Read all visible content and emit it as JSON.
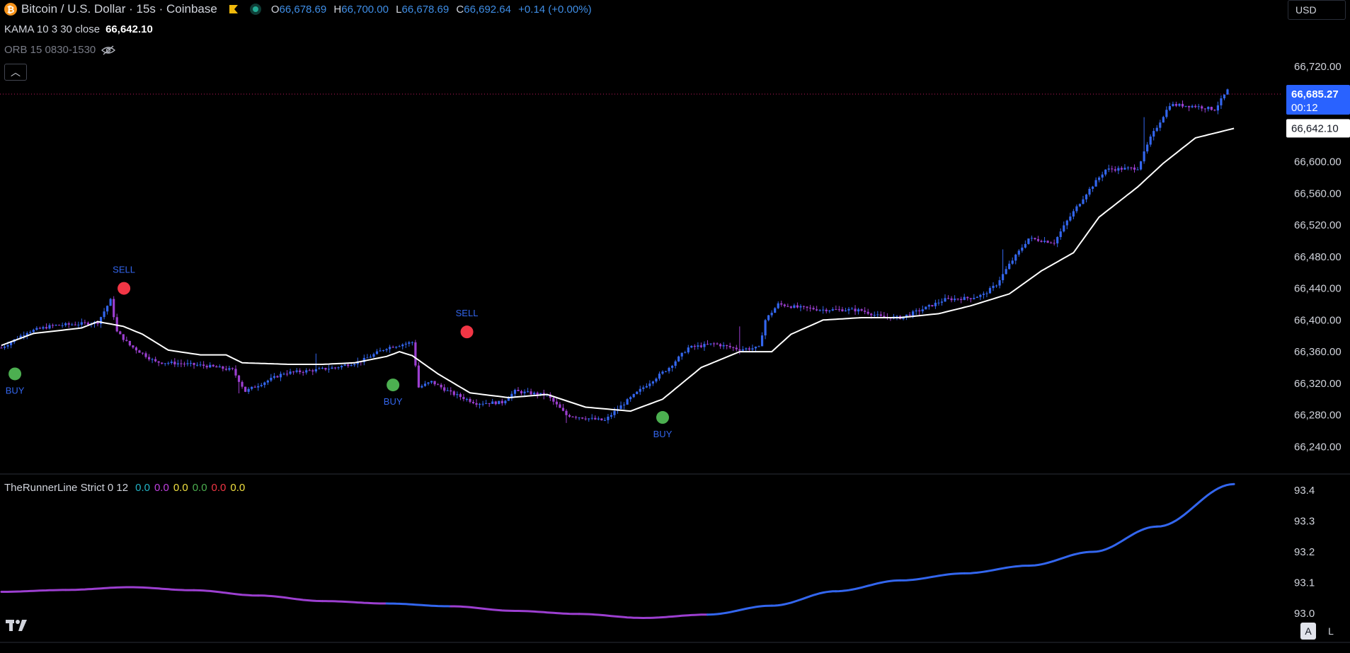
{
  "header": {
    "symbol_title": "Bitcoin / U.S. Dollar · 15s · Coinbase",
    "open_label": "O",
    "open": "66,678.69",
    "high_label": "H",
    "high": "66,700.00",
    "low_label": "L",
    "low": "66,678.69",
    "close_label": "C",
    "close": "66,692.64",
    "change": "+0.14 (+0.00%)",
    "currency": "USD"
  },
  "indicators": {
    "kama_label": "KAMA 10 3 30 close",
    "kama_value": "66,642.10",
    "orb_label": "ORB 15 0830-1530",
    "runner_label": "TheRunnerLine Strict 0 12",
    "runner_values": [
      "0.0",
      "0.0",
      "0.0",
      "0.0",
      "0.0",
      "0.0"
    ],
    "runner_value_colors": [
      "#22b3c6",
      "#c040e0",
      "#f0e040",
      "#4caf50",
      "#f23645",
      "#f0e040"
    ]
  },
  "price_tags": {
    "last_price": "66,685.27",
    "countdown": "00:12",
    "kama_tag": "66,642.10"
  },
  "bottom_controls": {
    "auto": "A",
    "log": "L"
  },
  "colors": {
    "up": "#3366ee",
    "down": "#9c3fd0",
    "kama": "#ffffff",
    "buy": "#4caf50",
    "sell": "#f23645",
    "signal_text": "#3366ee",
    "last_price_bg": "#2962ff"
  },
  "chart_data": [
    {
      "type": "candlestick",
      "title": "Bitcoin / U.S. Dollar · 15s · Coinbase",
      "ylim": [
        66210,
        66755
      ],
      "y_ticks": [
        "66,720.00",
        "66,680.00",
        "66,640.00",
        "66,600.00",
        "66,560.00",
        "66,520.00",
        "66,480.00",
        "66,440.00",
        "66,400.00",
        "66,360.00",
        "66,320.00",
        "66,280.00",
        "66,240.00"
      ],
      "price_segments": [
        [
          0,
          66365
        ],
        [
          8,
          66385
        ],
        [
          16,
          66393
        ],
        [
          24,
          66395
        ],
        [
          30,
          66397
        ],
        [
          34,
          66425
        ],
        [
          36,
          66385
        ],
        [
          40,
          66368
        ],
        [
          48,
          66347
        ],
        [
          56,
          66345
        ],
        [
          64,
          66342
        ],
        [
          72,
          66337
        ],
        [
          76,
          66310
        ],
        [
          80,
          66318
        ],
        [
          88,
          66333
        ],
        [
          96,
          66336
        ],
        [
          104,
          66340
        ],
        [
          112,
          66348
        ],
        [
          120,
          66365
        ],
        [
          128,
          66372
        ],
        [
          130,
          66315
        ],
        [
          134,
          66322
        ],
        [
          140,
          66308
        ],
        [
          148,
          66295
        ],
        [
          156,
          66296
        ],
        [
          160,
          66310
        ],
        [
          170,
          66305
        ],
        [
          176,
          66280
        ],
        [
          184,
          66275
        ],
        [
          188,
          66273
        ],
        [
          192,
          66288
        ],
        [
          200,
          66315
        ],
        [
          208,
          66340
        ],
        [
          214,
          66365
        ],
        [
          222,
          66370
        ],
        [
          230,
          66363
        ],
        [
          236,
          66365
        ],
        [
          238,
          66400
        ],
        [
          242,
          66420
        ],
        [
          248,
          66416
        ],
        [
          256,
          66413
        ],
        [
          264,
          66413
        ],
        [
          268,
          66412
        ],
        [
          274,
          66404
        ],
        [
          280,
          66403
        ],
        [
          286,
          66412
        ],
        [
          294,
          66426
        ],
        [
          302,
          66428
        ],
        [
          306,
          66432
        ],
        [
          310,
          66445
        ],
        [
          314,
          66470
        ],
        [
          320,
          66503
        ],
        [
          328,
          66498
        ],
        [
          332,
          66525
        ],
        [
          338,
          66560
        ],
        [
          344,
          66590
        ],
        [
          354,
          66592
        ],
        [
          358,
          66630
        ],
        [
          364,
          66672
        ],
        [
          372,
          66670
        ],
        [
          378,
          66666
        ],
        [
          382,
          66690
        ]
      ],
      "candle_count": 383,
      "kama_segments": [
        [
          0,
          66368
        ],
        [
          10,
          66383
        ],
        [
          25,
          66390
        ],
        [
          30,
          66398
        ],
        [
          38,
          66392
        ],
        [
          44,
          66382
        ],
        [
          52,
          66362
        ],
        [
          62,
          66356
        ],
        [
          70,
          66356
        ],
        [
          75,
          66346
        ],
        [
          90,
          66344
        ],
        [
          100,
          66344
        ],
        [
          110,
          66346
        ],
        [
          120,
          66354
        ],
        [
          124,
          66360
        ],
        [
          128,
          66355
        ],
        [
          136,
          66332
        ],
        [
          146,
          66308
        ],
        [
          158,
          66302
        ],
        [
          170,
          66306
        ],
        [
          182,
          66290
        ],
        [
          196,
          66285
        ],
        [
          206,
          66300
        ],
        [
          218,
          66340
        ],
        [
          230,
          66360
        ],
        [
          240,
          66360
        ],
        [
          246,
          66382
        ],
        [
          256,
          66400
        ],
        [
          268,
          66403
        ],
        [
          280,
          66403
        ],
        [
          292,
          66408
        ],
        [
          302,
          66418
        ],
        [
          314,
          66433
        ],
        [
          324,
          66462
        ],
        [
          334,
          66485
        ],
        [
          342,
          66530
        ],
        [
          354,
          66568
        ],
        [
          362,
          66598
        ],
        [
          372,
          66630
        ],
        [
          380,
          66638
        ],
        [
          384,
          66642
        ]
      ],
      "last_price": 66685.27,
      "kama_last": 66642.1,
      "signals": [
        {
          "label": "BUY",
          "type": "buy",
          "index": 2,
          "price": 66332
        },
        {
          "label": "SELL",
          "type": "sell",
          "index": 32,
          "price": 66440
        },
        {
          "label": "BUY",
          "type": "buy",
          "index": 122,
          "price": 66318
        },
        {
          "label": "SELL",
          "type": "sell",
          "index": 134,
          "price": 66385
        },
        {
          "label": "BUY",
          "type": "buy",
          "index": 206,
          "price": 66277
        }
      ]
    },
    {
      "type": "line",
      "title": "TheRunnerLine Strict 0 12",
      "ylim": [
        92.97,
        93.43
      ],
      "y_ticks": [
        "93.4",
        "93.3",
        "93.2",
        "93.1",
        "93.0"
      ],
      "x_index": [
        0,
        20,
        40,
        60,
        80,
        100,
        120,
        140,
        160,
        180,
        200,
        220,
        240,
        260,
        280,
        300,
        320,
        340,
        360,
        384
      ],
      "values": [
        93.07,
        93.076,
        93.085,
        93.075,
        93.058,
        93.04,
        93.032,
        93.023,
        93.008,
        92.998,
        92.985,
        92.996,
        93.025,
        93.072,
        93.107,
        93.13,
        93.155,
        93.2,
        93.282,
        93.42
      ],
      "segment_colors": [
        "#9c3fd0",
        "#9c3fd0",
        "#9c3fd0",
        "#9c3fd0",
        "#9c3fd0",
        "#9c3fd0",
        "#3366ee",
        "#9c3fd0",
        "#9c3fd0",
        "#9c3fd0",
        "#9c3fd0",
        "#3366ee",
        "#3366ee",
        "#3366ee",
        "#3366ee",
        "#3366ee",
        "#3366ee",
        "#3366ee",
        "#3366ee"
      ]
    }
  ]
}
